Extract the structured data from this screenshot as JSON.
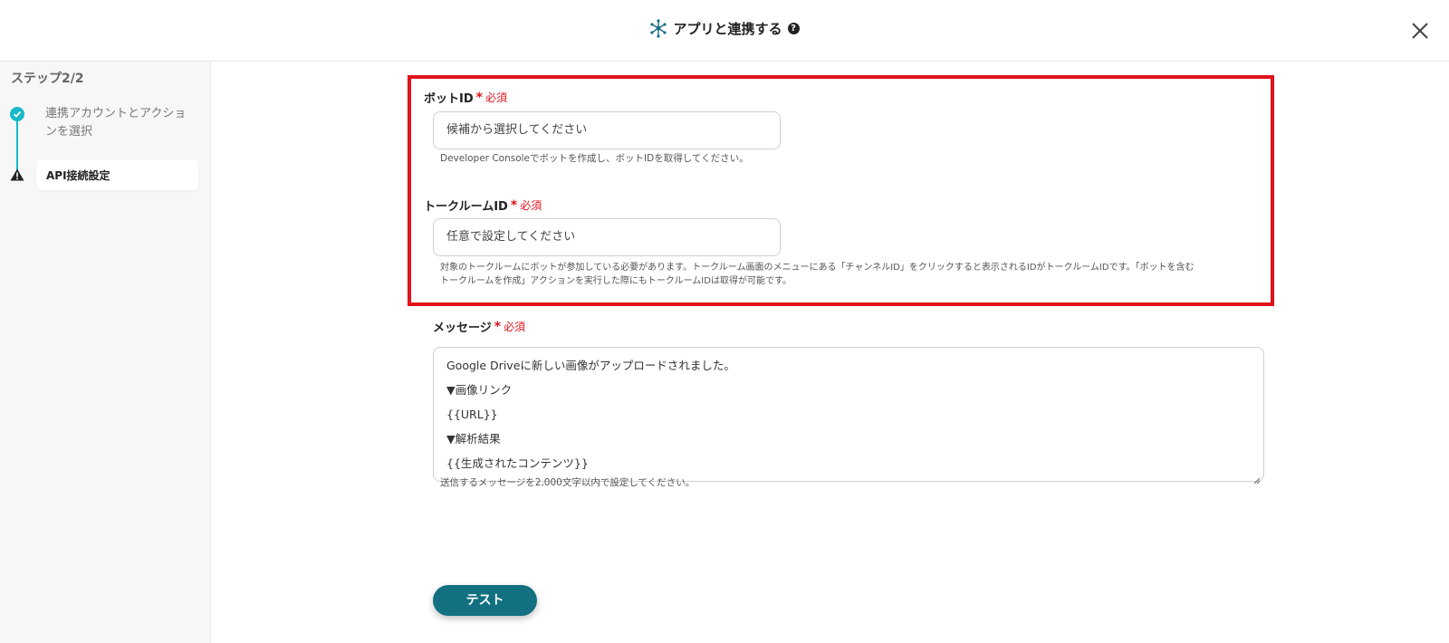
{
  "header": {
    "title": "アプリと連携する",
    "help_glyph": "?",
    "app_icon": "network-nodes-icon",
    "close_icon": "close-icon"
  },
  "sidebar": {
    "step_title": "ステップ2/2",
    "steps": [
      {
        "label": "連携アカウントとアクションを選択",
        "status": "complete"
      },
      {
        "label": "API接続設定",
        "status": "warning"
      }
    ]
  },
  "form": {
    "required_text": "必須",
    "bot_id": {
      "label": "ボットID",
      "placeholder": "候補から選択してください",
      "hint": "Developer Consoleでボットを作成し、ボットIDを取得してください。"
    },
    "room_id": {
      "label": "トークルームID",
      "placeholder": "任意で設定してください",
      "hint_line1": "対象のトークルームにボットが参加している必要があります。トークルーム画面のメニューにある「チャンネルID」をクリックすると表示されるIDがトークルームIDです。「ボットを含む",
      "hint_line2": "トークルームを作成」アクションを実行した際にもトークルームIDは取得が可能です。"
    },
    "message": {
      "label": "メッセージ",
      "lines": [
        "Google Driveに新しい画像がアップロードされました。",
        "▼画像リンク",
        "{{URL}}",
        "▼解析結果",
        "{{生成されたコンテンツ}}"
      ],
      "hint": "送信するメッセージを2,000文字以内で設定してください。"
    },
    "test_button": "テスト"
  },
  "colors": {
    "accent": "#18b8c8",
    "highlight": "#e0121a",
    "button": "#127080"
  }
}
